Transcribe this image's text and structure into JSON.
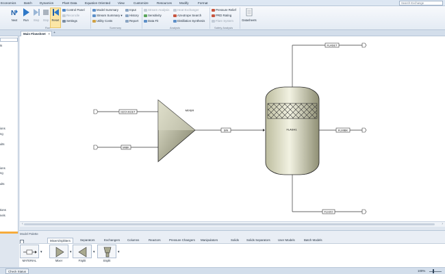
{
  "menu": {
    "items": [
      "Economics",
      "Batch",
      "Dynamics",
      "Plant Data",
      "Equation Oriented",
      "View",
      "Customize",
      "Resources",
      "Modify",
      "Format"
    ],
    "search_placeholder": "Search Exchange"
  },
  "ribbon": {
    "run_group": {
      "label": "Run",
      "buttons": [
        {
          "label": "Next",
          "icon": "next-icon",
          "dim": false
        },
        {
          "label": "Run",
          "icon": "run-icon",
          "dim": false
        },
        {
          "label": "Step",
          "icon": "step-icon",
          "dim": true
        },
        {
          "label": "Stop",
          "icon": "stop-icon",
          "dim": true
        },
        {
          "label": "Reset",
          "icon": "reset-icon",
          "dim": false
        }
      ],
      "items": [
        "Control Panel",
        "Reconcile",
        "Settings"
      ]
    },
    "summary_group": {
      "label": "Summary",
      "col1": [
        "Model Summary",
        "Stream Summary",
        "Utility Costs"
      ],
      "col2": [
        "Input",
        "History",
        "Report"
      ]
    },
    "analysis_group": {
      "label": "Analysis",
      "col1": [
        "Stream Analysis",
        "Sensitivity",
        "Data Fit"
      ],
      "col2": [
        "Heat Exchanger",
        "Azeotrope Search",
        "Distillation Synthesis"
      ]
    },
    "safety_group": {
      "label": "Safety Analysis",
      "items": [
        "Pressure Relief",
        "PRD Rating",
        "Flare System"
      ]
    },
    "datasheets_label": "Datasheets"
  },
  "tabs": {
    "active": "Main Flowsheet",
    "close": "×",
    "add": "+"
  },
  "left_panel": {
    "fragments": [
      "ts",
      "ions",
      "ng",
      "ults",
      "ions",
      "ng",
      "ults",
      "tions",
      "nels"
    ]
  },
  "flowsheet": {
    "streams": {
      "h2o": "H2O+ACET",
      "mibk": "MIBK",
      "sin": "SIN",
      "flaset": "FLASET",
      "flmibk": "FLMIBK",
      "flh2o": "FLH2O"
    },
    "blocks": {
      "mixer": "MIXER",
      "flash": "FLASH1"
    }
  },
  "scroll": {
    "left": "‹",
    "right": "›"
  },
  "palette": {
    "title": "Model Palette",
    "tabs": [
      "Mixers/Splitters",
      "Separators",
      "Exchangers",
      "Columns",
      "Reactors",
      "Pressure Changers",
      "Manipulators",
      "Solids",
      "Solids Separators",
      "User Models",
      "Batch Models"
    ],
    "active_tab": "Mixers/Splitters",
    "blocks": [
      {
        "label": "MATERIAL",
        "icon": "material-stream-icon"
      },
      {
        "label": "Mixer",
        "icon": "mixer-icon"
      },
      {
        "label": "FSplit",
        "icon": "fsplit-icon"
      },
      {
        "label": "SSplit",
        "icon": "ssplit-icon"
      }
    ]
  },
  "status": {
    "check_status": "Check Status",
    "zoom": "100%"
  },
  "colors": {
    "ribbon_bg": "#eef2f8",
    "reset_highlight": "#fbe6a6",
    "panel_highlight": "#f6ab3b",
    "vessel_fill": "#c8c8ad"
  }
}
